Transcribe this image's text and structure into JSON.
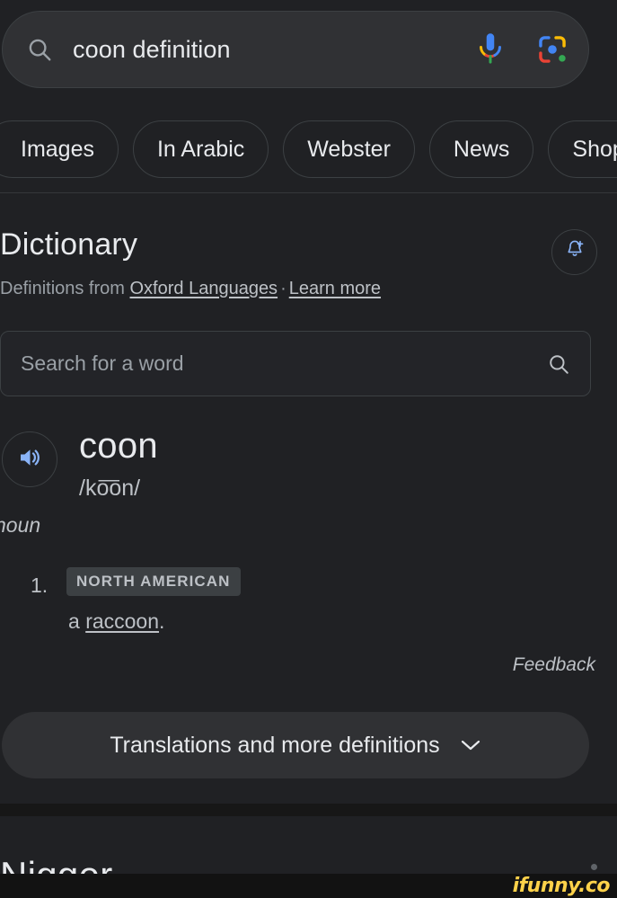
{
  "colors": {
    "page_bg": "#202124",
    "surface": "#303134",
    "border": "#3c4043",
    "text_primary": "#e8eaed",
    "text_secondary": "#bdc1c6",
    "text_muted": "#9aa0a6",
    "accent_blue": "#8ab4f8",
    "google_blue": "#4285f4",
    "google_red": "#ea4335",
    "google_yellow": "#fbbc05",
    "google_green": "#34a853",
    "watermark_yellow": "#ffd24a"
  },
  "search": {
    "query": "coon definition",
    "search_icon": "search-icon",
    "mic_icon": "google-microphone-icon",
    "lens_icon": "google-lens-icon"
  },
  "chips": [
    {
      "label": "Images"
    },
    {
      "label": "In Arabic"
    },
    {
      "label": "Webster"
    },
    {
      "label": "News"
    },
    {
      "label": "Shopping"
    }
  ],
  "dictionary": {
    "title": "Dictionary",
    "source_prefix": "Definitions from",
    "source_link": "Oxford Languages",
    "separator": "·",
    "learn_more": "Learn more",
    "notify_icon": "add-alert-bell-icon",
    "word_search_placeholder": "Search for a word",
    "word_search_value": "",
    "word_search_icon": "search-icon",
    "speaker_icon": "volume-up-icon",
    "headword": "coon",
    "phonetic": "/ko͞on/",
    "part_of_speech": "noun",
    "senses": [
      {
        "number": "1.",
        "register": "NORTH AMERICAN",
        "text_before": "a ",
        "link": "raccoon",
        "text_after": "."
      }
    ],
    "feedback": "Feedback",
    "translations_label": "Translations and more definitions",
    "translations_chevron": "chevron-down-icon"
  },
  "next_card": {
    "title": "Nigger"
  },
  "watermark": {
    "text": "ifunny.co"
  }
}
